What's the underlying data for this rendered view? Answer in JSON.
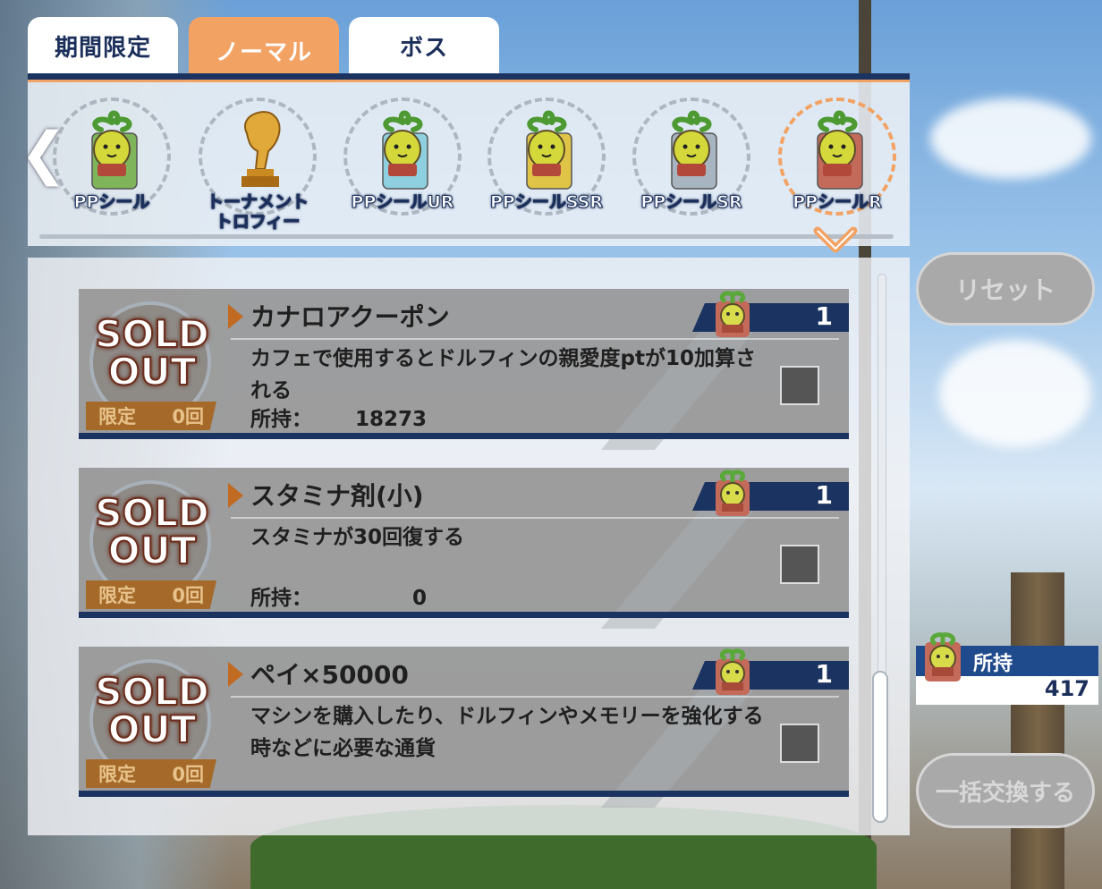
{
  "tabs": [
    "期間限定",
    "ノーマル",
    "ボス"
  ],
  "active_tab": "ノーマル",
  "currency_items": [
    {
      "label": "PPシール",
      "card_color": "#7fb45a"
    },
    {
      "label": "トーナメント\nトロフィー",
      "card_color": "#e0a93a"
    },
    {
      "label": "PPシールUR",
      "card_color": "#8fd0e0"
    },
    {
      "label": "PPシールSSR",
      "card_color": "#e0c448"
    },
    {
      "label": "PPシールSR",
      "card_color": "#a8b4c0"
    },
    {
      "label": "PPシールR",
      "card_color": "#c46a5a"
    }
  ],
  "items": [
    {
      "title": "カナロアクーポン",
      "desc": "カフェで使用するとドルフィンの親愛度ptが10加算される",
      "owned_label": "所持：",
      "owned": "18273",
      "cost": "1",
      "sold_out": "SOLD OUT",
      "limit_label": "限定",
      "limit_count": "0回"
    },
    {
      "title": "スタミナ剤(小)",
      "desc": "スタミナが30回復する",
      "owned_label": "所持：",
      "owned": "0",
      "cost": "1",
      "sold_out": "SOLD OUT",
      "limit_label": "限定",
      "limit_count": "0回"
    },
    {
      "title": "ペイ×50000",
      "desc": "マシンを購入したり、ドルフィンやメモリーを強化する時などに必要な通貨",
      "owned_label": "",
      "owned": "",
      "cost": "1",
      "sold_out": "SOLD OUT",
      "limit_label": "限定",
      "limit_count": "0回"
    }
  ],
  "reset_label": "リセット",
  "owned_panel": {
    "label": "所持",
    "value": "417"
  },
  "bulk_label": "一括交換する",
  "colors": {
    "accent": "#f2a263",
    "navy": "#1b3360"
  }
}
